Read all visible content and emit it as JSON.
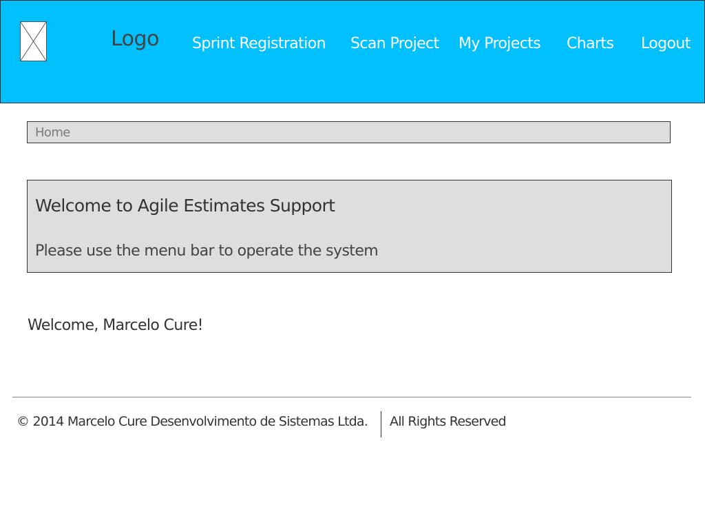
{
  "header": {
    "logo_text": "Logo",
    "nav": [
      {
        "label": "Sprint Registration"
      },
      {
        "label": "Scan Project"
      },
      {
        "label": "My Projects"
      },
      {
        "label": "Charts"
      },
      {
        "label": "Logout"
      }
    ],
    "background": "#00c0ff"
  },
  "breadcrumb": {
    "label": "Home"
  },
  "welcome": {
    "title": "Welcome to Agile Estimates Support",
    "subtitle": "Please use the menu bar to operate the system"
  },
  "user": {
    "greeting": "Welcome, Marcelo Cure!"
  },
  "footer": {
    "copyright": "© 2014 Marcelo Cure Desenvolvimento de Sistemas Ltda.",
    "rights": "All Rights Reserved"
  }
}
